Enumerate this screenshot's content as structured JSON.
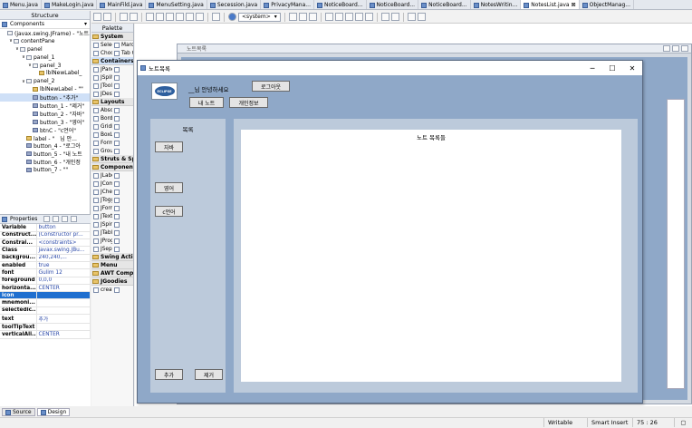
{
  "editor_tabs": [
    {
      "label": "Menu.java"
    },
    {
      "label": "MakeLogin.java"
    },
    {
      "label": "MainFild.java"
    },
    {
      "label": "MenuSetting.java"
    },
    {
      "label": "Secession.java"
    },
    {
      "label": "PrivacyMana..."
    },
    {
      "label": "NoticeBoard..."
    },
    {
      "label": "NoticeBoard..."
    },
    {
      "label": "NoticeBoard..."
    },
    {
      "label": "NotesWritin..."
    },
    {
      "label": "NotesList.java",
      "active": true
    },
    {
      "label": "ObjectManag..."
    }
  ],
  "structure": {
    "title": "Structure",
    "components_label": "Components",
    "tree": [
      {
        "label": "(javax.swing.JFrame) - \"노트...",
        "indent": 0,
        "toggle": "",
        "icon": "frame"
      },
      {
        "label": "contentPane",
        "indent": 1,
        "toggle": "∨",
        "icon": "panel"
      },
      {
        "label": "panel",
        "indent": 2,
        "toggle": "∨",
        "icon": "panel"
      },
      {
        "label": "panel_1",
        "indent": 3,
        "toggle": "∨",
        "icon": "panel"
      },
      {
        "label": "panel_3",
        "indent": 4,
        "toggle": "∨",
        "icon": "panel"
      },
      {
        "label": "lblNewLabel_",
        "indent": 5,
        "toggle": "",
        "icon": "lbl"
      },
      {
        "label": "panel_2",
        "indent": 3,
        "toggle": "∨",
        "icon": "panel"
      },
      {
        "label": "lblNewLabel - \"\"",
        "indent": 4,
        "toggle": "",
        "icon": "lbl"
      },
      {
        "label": "button - \"추가\"",
        "indent": 4,
        "toggle": "",
        "icon": "btn",
        "selected": true
      },
      {
        "label": "button_1 - \"제거\"",
        "indent": 4,
        "toggle": "",
        "icon": "btn"
      },
      {
        "label": "button_2 - \"자바\"",
        "indent": 4,
        "toggle": "",
        "icon": "btn"
      },
      {
        "label": "button_3 - \"영어\"",
        "indent": 4,
        "toggle": "",
        "icon": "btn"
      },
      {
        "label": "btnC - \"c언어\"",
        "indent": 4,
        "toggle": "",
        "icon": "btn"
      },
      {
        "label": "label - \"__님 안...",
        "indent": 3,
        "toggle": "",
        "icon": "lbl"
      },
      {
        "label": "button_4 - \"로그아",
        "indent": 3,
        "toggle": "",
        "icon": "btn"
      },
      {
        "label": "button_5 - \"내 노트",
        "indent": 3,
        "toggle": "",
        "icon": "btn"
      },
      {
        "label": "button_6 - \"개인정",
        "indent": 3,
        "toggle": "",
        "icon": "btn"
      },
      {
        "label": "button_7 - \"\"",
        "indent": 3,
        "toggle": "",
        "icon": "btn"
      }
    ]
  },
  "properties": {
    "title": "Properties",
    "rows": [
      {
        "key": "Variable",
        "value": "button"
      },
      {
        "key": "Construct...",
        "value": "(Constructor pr..."
      },
      {
        "key": "Constrai...",
        "value": "<constraints>"
      },
      {
        "key": "Class",
        "value": "javax.swing.JBu..."
      },
      {
        "key": "backgrou...",
        "value": "240,240,..."
      },
      {
        "key": "enabled",
        "value": "true"
      },
      {
        "key": "font",
        "value": "Gulim 12"
      },
      {
        "key": "foreground",
        "value": "0,0,0"
      },
      {
        "key": "horizonta...",
        "value": "CENTER"
      },
      {
        "key": "icon",
        "value": "",
        "selected": true
      },
      {
        "key": "mnemoni...",
        "value": ""
      },
      {
        "key": "selectedic...",
        "value": ""
      },
      {
        "key": "text",
        "value": "추가"
      },
      {
        "key": "toolTipText",
        "value": ""
      },
      {
        "key": "verticalAli...",
        "value": "CENTER"
      }
    ]
  },
  "palette": {
    "title": "Palette",
    "sections": [
      {
        "label": "System",
        "items": [
          "Selecti...",
          "Marquee",
          "Choose...",
          "Tab Or..."
        ]
      },
      {
        "label": "Containers",
        "selected": true,
        "items": [
          "JPanel",
          "",
          "JSplitP...",
          "",
          "JToolBar",
          "",
          "JDeskt...",
          ""
        ]
      },
      {
        "label": "Layouts",
        "items": [
          "Absolu...",
          "",
          "Border...",
          "",
          "GridBa...",
          "",
          "BoxLay...",
          "",
          "FormLa...",
          "",
          "GroupL...",
          ""
        ]
      },
      {
        "label": "Struts & Sprin",
        "items": []
      },
      {
        "label": "Components",
        "items": [
          "JLabel",
          "",
          "JComb...",
          "",
          "JCheck...",
          "",
          "JToggle...",
          "",
          "JForma...",
          "",
          "JTextPa...",
          "",
          "JSpinner",
          "",
          "JTable",
          "",
          "JProgre...",
          "",
          "JSepara...",
          ""
        ]
      },
      {
        "label": "Swing Actions",
        "items": []
      },
      {
        "label": "Menu",
        "items": []
      },
      {
        "label": "AWT Compon",
        "items": []
      },
      {
        "label": "JGoodies",
        "items": [
          "createL...",
          ""
        ]
      }
    ]
  },
  "toolbar": {
    "lookandfeel": "<system>"
  },
  "ghost_frame": {
    "title": "노트목록"
  },
  "app": {
    "title": "노트목록",
    "logo_text": "ECLIPSE",
    "greeting": "__님 안녕하세요",
    "logout": "로그아웃",
    "my_notes": "내 노트",
    "privacy": "개인정보",
    "sidebar_title": "목록",
    "subjects": [
      "자바",
      "영어",
      "c언어"
    ],
    "add": "추가",
    "remove": "제거",
    "main_title": "노트 목록들",
    "controls": {
      "minimize": "─",
      "maximize": "☐",
      "close": "✕"
    }
  },
  "bottom": {
    "source_tab": "Source",
    "design_tab": "Design",
    "writable": "Writable",
    "insert_mode": "Smart Insert",
    "cursor": "75 : 26"
  }
}
